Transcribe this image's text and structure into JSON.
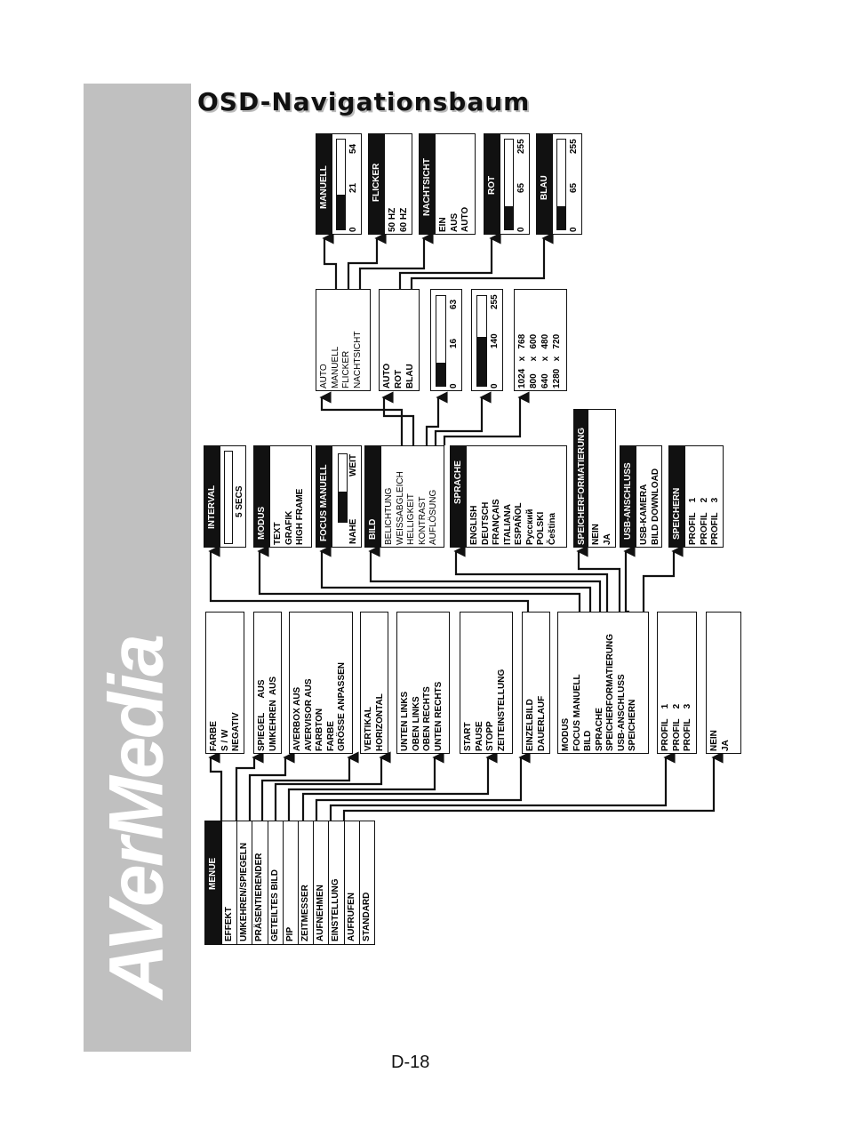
{
  "page": {
    "title": "OSD-Navigationsbaum",
    "page_number": "D-18",
    "brand_logo": "AVerMedia"
  },
  "menu": {
    "header": "MENUE",
    "items": [
      "EFFEKT",
      "UMKEHREN/SPIEGELN",
      "PRÄSENTIERENDER",
      "GETEILTES BILD",
      "PIP",
      "ZEITMESSER",
      "AUFNEHMEN",
      "EINSTELLUNG",
      "AUFRUFEN",
      "STANDARD"
    ]
  },
  "level1": [
    {
      "id": "effekt",
      "items": [
        "FARBE",
        "S / W",
        "NEGATIV"
      ]
    },
    {
      "id": "umkehren",
      "items": [
        "SPIEGEL      AUS",
        "UMKEHREN  AUS"
      ]
    },
    {
      "id": "praesentierender",
      "items": [
        "AVERBOX AUS",
        "AVERVISOR AUS",
        "FARBTON",
        "FARBE",
        "GRÖSSE ANPASSEN"
      ]
    },
    {
      "id": "geteiltes",
      "items": [
        "VERTIKAL",
        "HORIZONTAL"
      ]
    },
    {
      "id": "pip",
      "items": [
        "UNTEN LINKS",
        "OBEN LINKS",
        "OBEN RECHTS",
        "UNTEN RECHTS"
      ]
    },
    {
      "id": "zeitmesser",
      "items": [
        "START",
        "PAUSE",
        "STOPP",
        "ZEITEINSTELLUNG"
      ]
    },
    {
      "id": "aufnehmen",
      "items": [
        "EINZELBILD",
        "DAUERLAUF"
      ]
    },
    {
      "id": "einstellung",
      "items": [
        "MODUS",
        "FOCUS MANUELL",
        "BILD",
        "SPRACHE",
        "SPEICHERFORMATIERUNG",
        "USB-ANSCHLUSS",
        "SPEICHERN"
      ]
    },
    {
      "id": "aufrufen",
      "items": [
        "PROFIL    1",
        "PROFIL    2",
        "PROFIL    3"
      ]
    },
    {
      "id": "standard",
      "items": [
        "NEIN",
        "JA"
      ]
    }
  ],
  "level2": [
    {
      "id": "interval",
      "header": "INTERVAL",
      "items": [
        "5 SECS"
      ]
    },
    {
      "id": "modus",
      "header": "MODUS",
      "items": [
        "TEXT",
        "GRAFIK",
        "HIGH FRAME"
      ]
    },
    {
      "id": "focus",
      "header": "FOCUS MANUELL",
      "min_label": "NAHE",
      "max_label": "WEIT",
      "level_fraction": 0.45
    },
    {
      "id": "bild",
      "header": "BILD",
      "items": [
        "BELICHTUNG",
        "WEISSABGLEICH",
        "HELLIGKEIT",
        "KONTRAST",
        "AUFLÖSUNG"
      ]
    },
    {
      "id": "sprache",
      "header": "SPRACHE",
      "items": [
        "ENGLISH",
        "DEUTSCH",
        "FRANÇAIS",
        "ITALIANA",
        "ESPAÑOL",
        "Русский",
        "POLSKI",
        "Čeština"
      ]
    },
    {
      "id": "speicherformat",
      "header": "SPEICHERFORMATIERUNG",
      "items": [
        "NEIN",
        "JA"
      ]
    },
    {
      "id": "usb",
      "header": "USB-ANSCHLUSS",
      "items": [
        "USB-KAMERA",
        "BILD DOWNLOAD"
      ]
    },
    {
      "id": "speichern",
      "header": "SPEICHERN",
      "items": [
        "PROFIL    1",
        "PROFIL    2",
        "PROFIL    3"
      ]
    }
  ],
  "level3": [
    {
      "id": "belichtung",
      "items": [
        "AUTO",
        "MANUELL",
        "FLICKER",
        "NACHTSICHT"
      ]
    },
    {
      "id": "weissabgleich",
      "items": [
        "AUTO",
        "ROT",
        "BLAU"
      ]
    },
    {
      "id": "helligkeit",
      "min": "0",
      "value": "16",
      "max": "63",
      "fraction": 0.254
    },
    {
      "id": "kontrast",
      "min": "0",
      "value": "140",
      "max": "255",
      "fraction": 0.549
    },
    {
      "id": "aufloesung",
      "items": [
        "1024   x   768",
        "800     x   600",
        "640     x   480",
        "1280   x   720"
      ]
    }
  ],
  "level4": [
    {
      "id": "manuell",
      "header": "MANUELL",
      "min": "0",
      "value": "21",
      "max": "54",
      "fraction": 0.389
    },
    {
      "id": "flicker",
      "header": "FLICKER",
      "items": [
        "50 HZ",
        "60 HZ"
      ]
    },
    {
      "id": "nachtsicht",
      "header": "NACHTSICHT",
      "items": [
        "EIN",
        "AUS",
        "AUTO"
      ]
    },
    {
      "id": "rot",
      "header": "ROT",
      "min": "0",
      "value": "65",
      "max": "255",
      "fraction": 0.255
    },
    {
      "id": "blau",
      "header": "BLAU",
      "min": "0",
      "value": "65",
      "max": "255",
      "fraction": 0.255
    }
  ]
}
